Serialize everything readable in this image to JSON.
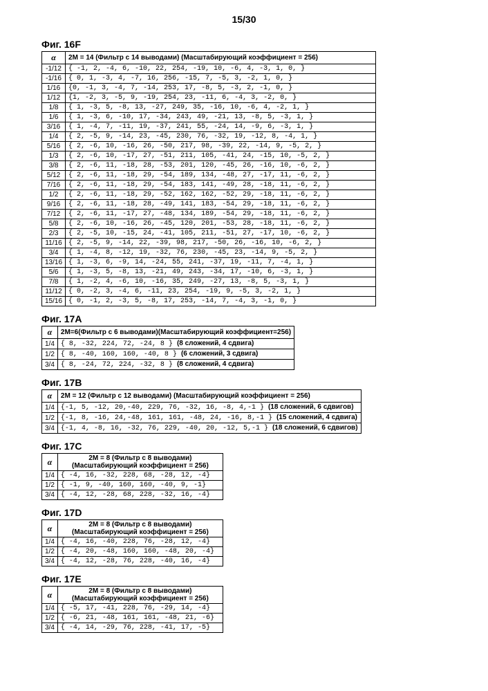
{
  "page_header": "15/30",
  "fig16f": {
    "label": "Фиг. 16F",
    "header_alpha": "α",
    "header_coef": "2M = 14 (Фильтр с 14 выводами) (Масштабирующий коэффициент = 256)",
    "rows": [
      {
        "a": "-1/12",
        "c": "{ -1, 2, -4, 6, -10, 22, 254, -19, 10, -6, 4, -3, 1, 0, }"
      },
      {
        "a": "-1/16",
        "c": "{ 0, 1, -3, 4, -7, 16, 256, -15, 7, -5, 3, -2, 1, 0, }"
      },
      {
        "a": "1/16",
        "c": "{0, -1, 3, -4, 7, -14, 253, 17, -8, 5, -3, 2, -1, 0, }"
      },
      {
        "a": "1/12",
        "c": "{1, -2, 3, -5, 9, -19, 254, 23, -11, 6, -4, 3, -2, 0, }"
      },
      {
        "a": "1/8",
        "c": "{ 1, -3, 5, -8, 13, -27, 249, 35, -16, 10, -6, 4, -2, 1, }"
      },
      {
        "a": "1/6",
        "c": "{ 1, -3, 6, -10, 17, -34, 243, 49, -21, 13, -8, 5, -3, 1, }"
      },
      {
        "a": "3/16",
        "c": "{ 1, -4, 7, -11, 19, -37, 241, 55, -24, 14, -9, 6, -3, 1, }"
      },
      {
        "a": "1/4",
        "c": "{ 2, -5, 9, -14, 23, -45, 230, 76, -32, 19, -12, 8, -4, 1, }"
      },
      {
        "a": "5/16",
        "c": "{ 2, -6, 10, -16, 26, -50, 217, 98, -39, 22, -14, 9, -5, 2, }"
      },
      {
        "a": "1/3",
        "c": "{ 2, -6, 10, -17, 27, -51, 211, 105, -41, 24, -15, 10, -5, 2, }"
      },
      {
        "a": "3/8",
        "c": "{ 2, -6, 11, -18, 28, -53, 201, 120, -45, 26, -16, 10, -6, 2, }"
      },
      {
        "a": "5/12",
        "c": "{ 2, -6, 11, -18, 29, -54, 189, 134, -48, 27, -17, 11, -6, 2, }"
      },
      {
        "a": "7/16",
        "c": "{ 2, -6, 11, -18, 29, -54, 183, 141, -49, 28, -18, 11, -6, 2, }"
      },
      {
        "a": "1/2",
        "c": "{ 2, -6, 11, -18, 29, -52, 162, 162, -52, 29, -18, 11, -6, 2, }"
      },
      {
        "a": "9/16",
        "c": "{ 2, -6, 11, -18, 28, -49, 141, 183, -54, 29, -18, 11, -6, 2, }"
      },
      {
        "a": "7/12",
        "c": "{ 2, -6, 11, -17, 27, -48, 134, 189, -54, 29, -18, 11, -6, 2, }"
      },
      {
        "a": "5/8",
        "c": "{ 2, -6, 10, -16, 26, -45, 120, 201, -53, 28, -18, 11, -6, 2, }"
      },
      {
        "a": "2/3",
        "c": "{ 2, -5, 10, -15, 24, -41, 105, 211, -51, 27, -17, 10, -6, 2, }"
      },
      {
        "a": "11/16",
        "c": "{ 2, -5, 9, -14, 22, -39, 98, 217, -50, 26, -16, 10, -6, 2, }"
      },
      {
        "a": "3/4",
        "c": "{ 1, -4, 8, -12, 19, -32, 76, 230, -45, 23, -14, 9, -5, 2, }"
      },
      {
        "a": "13/16",
        "c": "{ 1, -3, 6, -9, 14, -24, 55, 241, -37, 19, -11, 7, -4, 1, }"
      },
      {
        "a": "5/6",
        "c": "{ 1, -3, 5, -8, 13, -21, 49, 243, -34, 17, -10, 6, -3, 1, }"
      },
      {
        "a": "7/8",
        "c": "{ 1, -2, 4, -6, 10, -16, 35, 249, -27, 13, -8, 5, -3, 1, }"
      },
      {
        "a": "11/12",
        "c": "{ 0, -2, 3, -4, 6, -11, 23, 254, -19, 9, -5, 3, -2, 1, }"
      },
      {
        "a": "15/16",
        "c": "{ 0, -1, 2, -3, 5, -8, 17, 253, -14, 7, -4, 3, -1, 0, }"
      }
    ]
  },
  "fig17a": {
    "label": "Фиг. 17A",
    "header_alpha": "α",
    "header_coef": "2M=6(Фильтр с 6 выводами)(Масштабирующий коэффициент=256)",
    "rows": [
      {
        "a": "1/4",
        "c": "{  8, -32, 224,  72, -24,  8 }",
        "ann": "(8 сложений, 4 сдвига)"
      },
      {
        "a": "1/2",
        "c": "{  8, -40, 160, 160, -40,  8 }",
        "ann": "(6 сложений, 3 сдвига)"
      },
      {
        "a": "3/4",
        "c": "{  8, -24,  72, 224, -32,  8 }",
        "ann": "(8 сложений, 4 сдвига)"
      }
    ]
  },
  "fig17b": {
    "label": "Фиг. 17B",
    "header_alpha": "α",
    "header_coef": "2M = 12 (Фильтр с 12 выводами) (Масштабирующий коэффициент = 256)",
    "rows": [
      {
        "a": "1/4",
        "c": "{-1, 5, -12, 20,-40, 229, 76, -32, 16, -8, 4,-1 }",
        "ann": "(18 сложений, 6 сдвигов)"
      },
      {
        "a": "1/2",
        "c": "{-1, 8, -16, 24,-48, 161, 161, -48, 24, -16, 8,-1 }",
        "ann": "(15 сложений, 4 сдвига)"
      },
      {
        "a": "3/4",
        "c": "{-1, 4, -8, 16, -32, 76, 229, -40, 20, -12, 5,-1 }",
        "ann": "(18 сложений, 6 сдвигов)"
      }
    ]
  },
  "fig17c": {
    "label": "Фиг. 17C",
    "header_alpha": "α",
    "header_coef": "2M = 8 (Фильтр с 8 выводами)\n(Масштабирующий коэффициент = 256)",
    "rows": [
      {
        "a": "1/4",
        "c": "{ -4, 16, -32, 228,  68, -28, 12, -4}"
      },
      {
        "a": "1/2",
        "c": "{ -1,  9, -40, 160, 160, -40,  9, -1}"
      },
      {
        "a": "3/4",
        "c": "{ -4, 12, -28,  68, 228, -32, 16, -4}"
      }
    ]
  },
  "fig17d": {
    "label": "Фиг. 17D",
    "header_alpha": "α",
    "header_coef": "2M = 8 (Фильтр с 8 выводами)\n(Масштабирующий коэффициент = 256)",
    "rows": [
      {
        "a": "1/4",
        "c": "{ -4, 16, -40, 228,  76, -28, 12, -4}"
      },
      {
        "a": "1/2",
        "c": "{ -4, 20, -48, 160, 160, -48, 20, -4}"
      },
      {
        "a": "3/4",
        "c": "{ -4, 12, -28,  76, 228, -40, 16, -4}"
      }
    ]
  },
  "fig17e": {
    "label": "Фиг. 17E",
    "header_alpha": "α",
    "header_coef": "2M = 8 (Фильтр с 8 выводами)\n(Масштабирующий коэффициент = 256)",
    "rows": [
      {
        "a": "1/4",
        "c": "{ -5, 17, -41, 228,  76, -29, 14, -4}"
      },
      {
        "a": "1/2",
        "c": "{ -6, 21, -48, 161, 161, -48, 21, -6}"
      },
      {
        "a": "3/4",
        "c": "{ -4, 14, -29,  76, 228, -41, 17, -5}"
      }
    ]
  }
}
